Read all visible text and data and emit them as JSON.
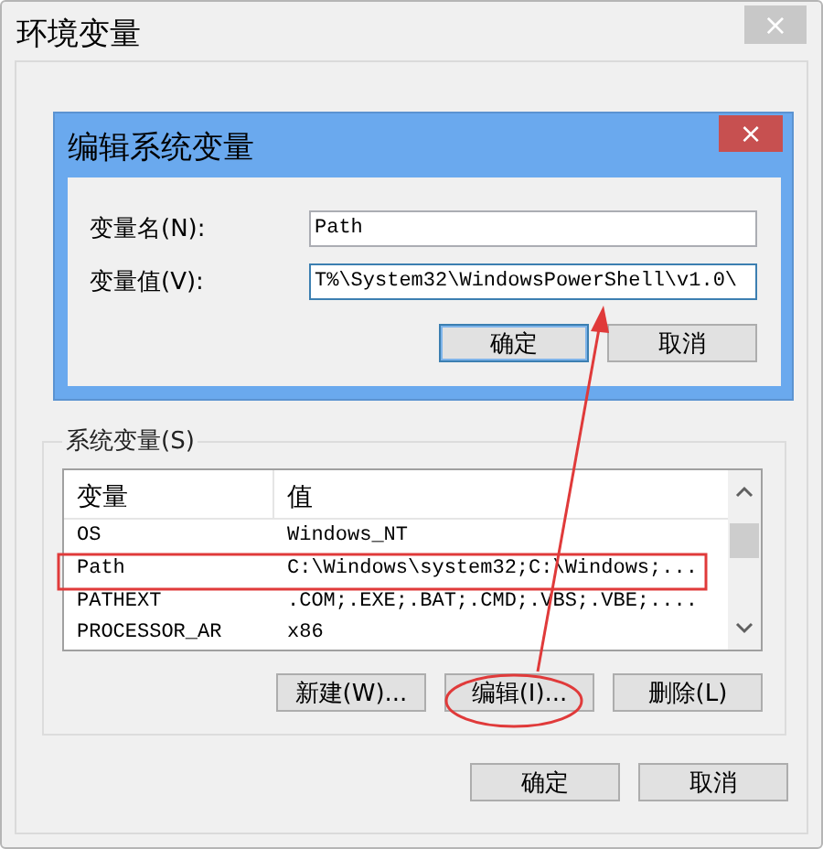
{
  "window": {
    "title": "环境变量",
    "close": "×"
  },
  "dialog": {
    "title": "编辑系统变量",
    "close": "×",
    "fields": [
      {
        "label": "变量名(N):",
        "value": "Path"
      },
      {
        "label": "变量值(V):",
        "value": "T%\\System32\\WindowsPowerShell\\v1.0\\"
      }
    ],
    "buttons": [
      {
        "label": "确定",
        "default": true
      },
      {
        "label": "取消",
        "default": false
      }
    ]
  },
  "system_variables": {
    "label": "系统变量(S)",
    "columns": [
      "变量",
      "值"
    ],
    "rows": [
      {
        "name": "OS",
        "value": "Windows_NT",
        "selected": false
      },
      {
        "name": "Path",
        "value": "C:\\Windows\\system32;C:\\Windows;...",
        "selected": false
      },
      {
        "name": "PATHEXT",
        "value": ".COM;.EXE;.BAT;.CMD;.VBS;.VBE;....",
        "selected": false
      },
      {
        "name": "PROCESSOR_AR",
        "value": "x86",
        "selected": false
      }
    ],
    "buttons": [
      "新建(W)...",
      "编辑(I)...",
      "删除(L)"
    ]
  },
  "buttons": [
    "确定",
    "取消"
  ],
  "annotations": [
    {
      "kind": "rectangle"
    },
    {
      "kind": "ellipse"
    },
    {
      "kind": "arrow"
    }
  ]
}
